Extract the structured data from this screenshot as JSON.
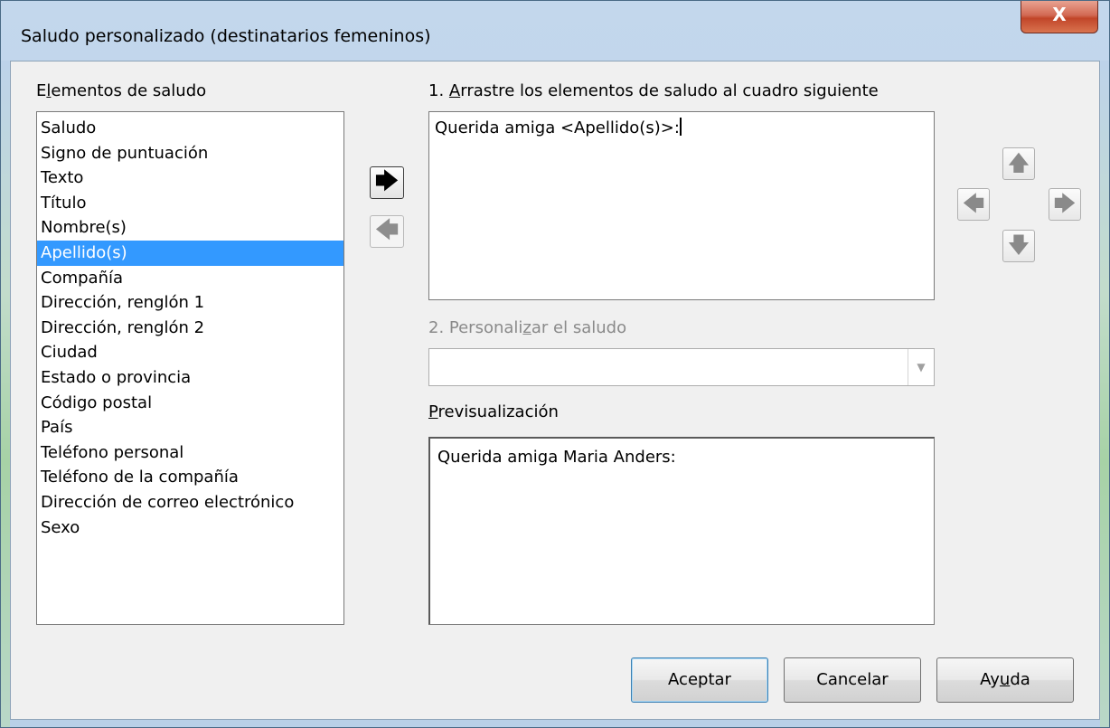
{
  "window": {
    "title": "Saludo personalizado (destinatarios femeninos)",
    "close_glyph": "X"
  },
  "elements": {
    "label_pre": "E",
    "label_u": "l",
    "label_post": "ementos de saludo",
    "items": [
      "Saludo",
      "Signo de puntuación",
      "Texto",
      "Título",
      "Nombre(s)",
      "Apellido(s)",
      "Compañía",
      "Dirección, renglón 1",
      "Dirección, renglón 2",
      "Ciudad",
      "Estado o provincia",
      "Código postal",
      "País",
      "Teléfono personal",
      "Teléfono de la compañía",
      "Dirección de correo electrónico",
      "Sexo"
    ],
    "selected_index": 5
  },
  "transfer": {
    "add_icon": "arrow-right-icon",
    "add_glyph": "🡆",
    "remove_icon": "arrow-left-icon",
    "remove_glyph": "🡄"
  },
  "step1": {
    "label_pre": "1. ",
    "label_u": "A",
    "label_post": "rrastre los elementos de saludo al cuadro siguiente",
    "content": "Querida amiga <Apellido(s)>:"
  },
  "step2": {
    "label_pre": "2. Personali",
    "label_u": "z",
    "label_post": "ar el saludo",
    "value": ""
  },
  "preview": {
    "label_u": "P",
    "label_post": "revisualización",
    "content": "Querida amiga Maria Anders:"
  },
  "move": {
    "up_glyph": "🡅",
    "left_glyph": "🡄",
    "right_glyph": "🡆",
    "down_glyph": "🡇"
  },
  "buttons": {
    "ok": "Aceptar",
    "cancel": "Cancelar",
    "help_pre": "Ay",
    "help_u": "u",
    "help_post": "da"
  },
  "colors": {
    "selection": "#3399ff",
    "dialog_bg": "#f0f0f0",
    "close_button": "#c94a2f"
  }
}
